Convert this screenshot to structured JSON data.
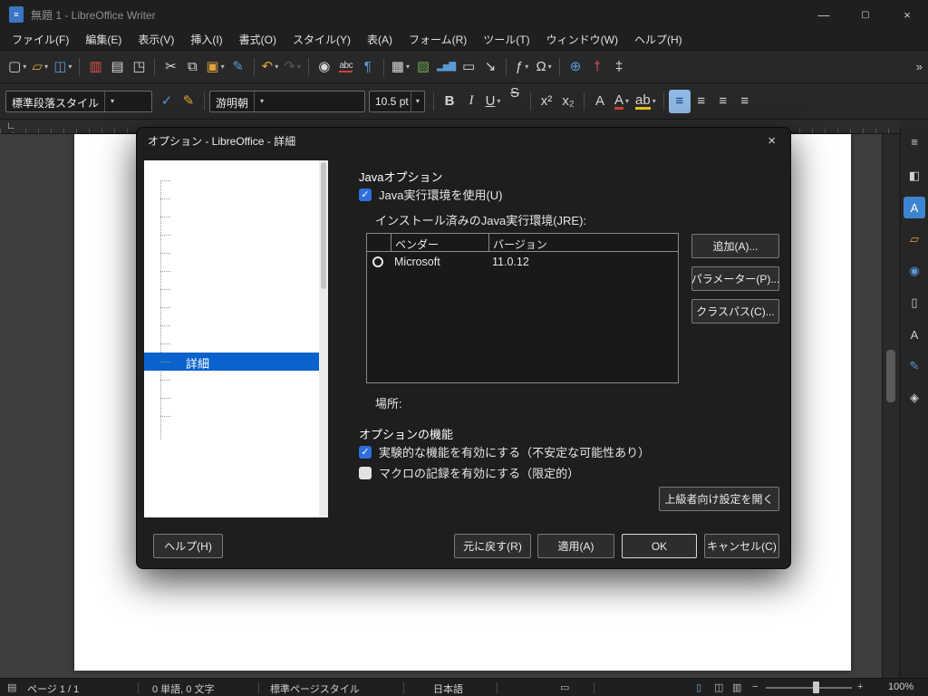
{
  "window": {
    "title": "無題 1 - LibreOffice Writer"
  },
  "menubar": {
    "items": [
      "ファイル(F)",
      "編集(E)",
      "表示(V)",
      "挿入(I)",
      "書式(O)",
      "スタイル(Y)",
      "表(A)",
      "フォーム(R)",
      "ツール(T)",
      "ウィンドウ(W)",
      "ヘルプ(H)"
    ]
  },
  "icons": {
    "app": "≡",
    "minimize": "—",
    "maximize": "▢",
    "close": "×",
    "dropdown": "▾",
    "overflow": "»",
    "check": "✓",
    "new_doc": "▢",
    "open": "▱",
    "save": "◫",
    "export_pdf": "▥",
    "print": "▤",
    "print_preview": "◳",
    "cut": "✂",
    "copy": "⧉",
    "paste": "▣",
    "clone_formatting": "✎",
    "undo": "↶",
    "redo": "↷",
    "find_replace": "◉",
    "spell_check": "abc",
    "formatting_marks": "¶",
    "insert_table": "▦",
    "insert_image": "▨",
    "insert_chart": "▂▅▇",
    "insert_textbox": "▭",
    "page_break": "↘",
    "insert_field": "ƒ",
    "special_char": "Ω",
    "hyperlink": "⊕",
    "footnote": "†",
    "endnote": "‡",
    "update_style": "✓",
    "new_style": "✎",
    "bold": "B",
    "italic": "I",
    "underline": "U",
    "strikethrough": "S",
    "superscript": "x²",
    "subscript": "x₂",
    "clear_format": "A",
    "font_color": "A",
    "highlight": "ab",
    "align": "≡",
    "sidebar_settings": "≡",
    "properties": "◧",
    "character": "A",
    "gallery": "▱",
    "media": "◉",
    "page": "▯",
    "styles": "A",
    "draw": "✎",
    "navigator": "◈",
    "tabstop": "∟",
    "status_doc": "▤",
    "selection_mode": "▭",
    "view_single": "▯",
    "view_multi": "◫",
    "view_book": "▥",
    "zoom_out": "−",
    "zoom_in": "+"
  },
  "format_toolbar": {
    "paragraph_style": "標準段落スタイル",
    "font_name": "游明朝",
    "font_size": "10.5 pt"
  },
  "dialog": {
    "title": "オプション - LibreOffice - 詳細",
    "tree": {
      "selected_label": "詳細"
    },
    "java": {
      "heading": "Javaオプション",
      "use_jre": "Java実行環境を使用(U)",
      "installed": "インストール済みのJava実行環境(JRE):",
      "columns": {
        "vendor": "ベンダー",
        "version": "バージョン"
      },
      "rows": [
        {
          "vendor": "Microsoft",
          "version": "11.0.12"
        }
      ],
      "add": "追加(A)...",
      "parameters": "パラメーター(P)...",
      "classpath": "クラスパス(C)...",
      "location": "場所:"
    },
    "optional": {
      "heading": "オプションの機能",
      "experimental": "実験的な機能を有効にする（不安定な可能性あり）",
      "macro": "マクロの記録を有効にする（限定的）",
      "expert": "上級者向け設定を開く"
    },
    "footer": {
      "help": "ヘルプ(H)",
      "reset": "元に戻す(R)",
      "apply": "適用(A)",
      "ok": "OK",
      "cancel": "キャンセル(C)"
    }
  },
  "statusbar": {
    "page": "ページ 1 / 1",
    "words": "0 単語, 0 文字",
    "page_style": "標準ページスタイル",
    "language": "日本語",
    "zoom_level": "100%"
  },
  "colors": {
    "accent_selection": "#0a63cc",
    "checkbox_blue": "#2e6fdb",
    "active_tool": "#8fb8e4"
  }
}
